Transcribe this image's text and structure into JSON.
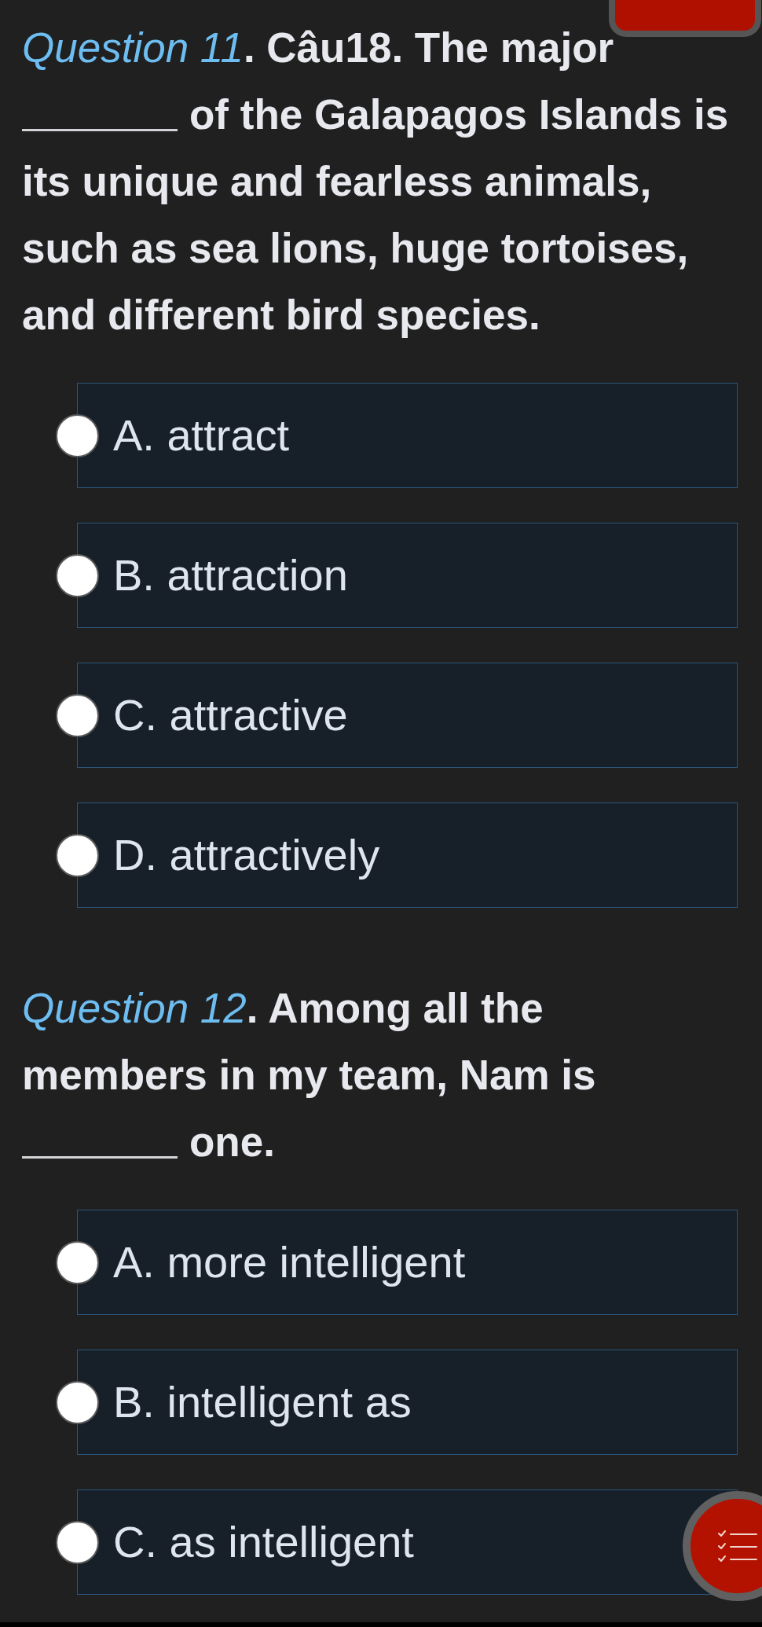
{
  "questions": [
    {
      "number": "Question 11",
      "lines": [
        {
          "segments": [
            {
              "kind": "text",
              "text": ". Câu18. The major"
            }
          ]
        },
        {
          "segments": [
            {
              "kind": "blank"
            },
            {
              "kind": "text",
              "text": "of the Galapagos Islands is"
            }
          ]
        },
        {
          "segments": [
            {
              "kind": "text",
              "text": "its unique and fearless animals,"
            }
          ]
        },
        {
          "segments": [
            {
              "kind": "text",
              "text": "such as sea lions, huge tortoises,"
            }
          ]
        },
        {
          "segments": [
            {
              "kind": "text",
              "text": "and different bird species."
            }
          ]
        }
      ],
      "options": [
        {
          "label": "A. attract",
          "selected": false
        },
        {
          "label": "B. attraction",
          "selected": false
        },
        {
          "label": "C. attractive",
          "selected": false
        },
        {
          "label": "D. attractively",
          "selected": false
        }
      ]
    },
    {
      "number": "Question 12",
      "lines": [
        {
          "segments": [
            {
              "kind": "text",
              "text": ". Among all the"
            }
          ]
        },
        {
          "segments": [
            {
              "kind": "text",
              "text": "members in my team, Nam is"
            }
          ]
        },
        {
          "segments": [
            {
              "kind": "blank"
            },
            {
              "kind": "text",
              "text": "one."
            }
          ]
        }
      ],
      "options": [
        {
          "label": "A. more intelligent",
          "selected": false
        },
        {
          "label": "B. intelligent as",
          "selected": false
        },
        {
          "label": "C. as intelligent",
          "selected": false
        }
      ]
    }
  ]
}
